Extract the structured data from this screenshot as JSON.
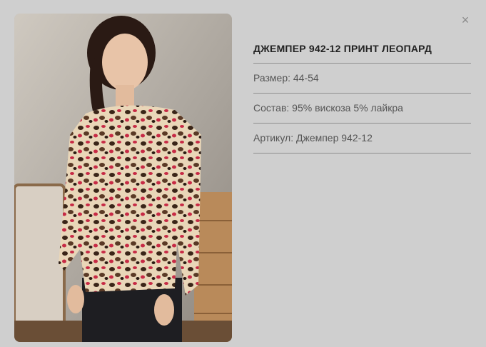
{
  "modal": {
    "close_glyph": "×"
  },
  "product": {
    "title": "ДЖЕМПЕР 942-12 ПРИНТ ЛЕОПАРД",
    "size": "Размер: 44-54",
    "composition": "Состав: 95% вискоза 5% лайкра",
    "article": "Артикул: Джемпер 942-12"
  },
  "colors": {
    "background": "#cfcfcf",
    "divider": "#8f8f8f",
    "title_text": "#222222",
    "body_text": "#555555"
  }
}
